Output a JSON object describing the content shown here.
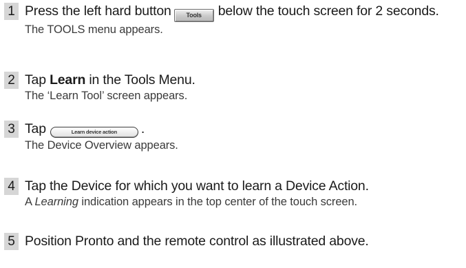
{
  "steps": [
    {
      "number": "1",
      "instr_before": "Press the left hard button",
      "button_label": "Tools",
      "instr_after": "below the touch screen for 2 seconds.",
      "result": "The TOOLS menu appears."
    },
    {
      "number": "2",
      "instr_before": "Tap ",
      "bold_word": "Learn",
      "instr_after": " in the Tools Menu.",
      "result": "The ‘Learn Tool’ screen appears."
    },
    {
      "number": "3",
      "instr_before": "Tap",
      "button_label": "Learn device action",
      "instr_after": ".",
      "result": "The Device Overview appears."
    },
    {
      "number": "4",
      "instruction": "Tap the Device for which you want to learn a Device Action.",
      "result_before": "A ",
      "result_italic": "Learning",
      "result_after": " indication appears in the top center of the touch screen."
    },
    {
      "number": "5",
      "instruction": "Position Pronto and the remote control as illustrated above."
    }
  ]
}
